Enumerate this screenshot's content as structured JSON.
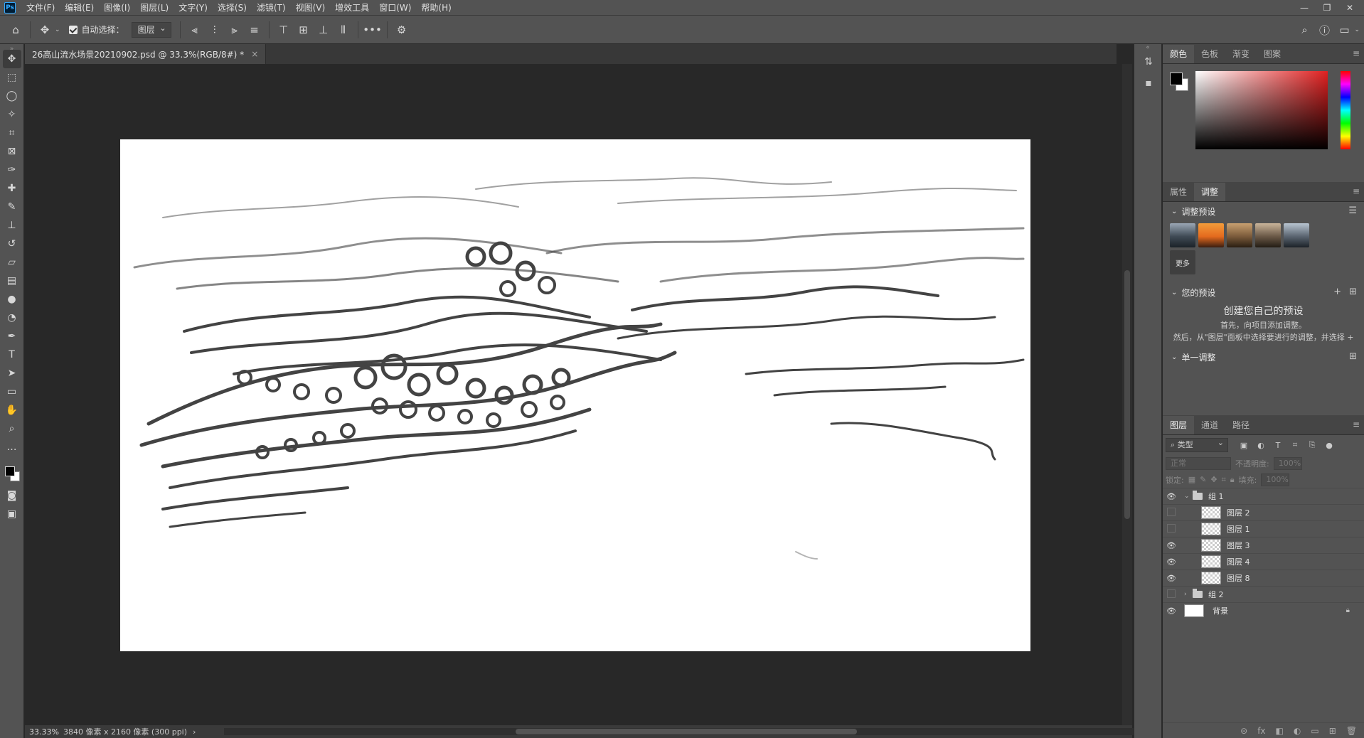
{
  "app": {
    "logo": "Ps"
  },
  "menu": [
    "文件(F)",
    "编辑(E)",
    "图像(I)",
    "图层(L)",
    "文字(Y)",
    "选择(S)",
    "滤镜(T)",
    "视图(V)",
    "增效工具",
    "窗口(W)",
    "帮助(H)"
  ],
  "options": {
    "auto_select_label": "自动选择：",
    "auto_select_value": "图层",
    "more": "•••"
  },
  "document": {
    "tab_title": "26高山流水场景20210902.psd @ 33.3%(RGB/8#) *",
    "close": "×"
  },
  "status": {
    "zoom": "33.33%",
    "info": "3840 像素 x 2160 像素 (300 ppi)",
    "arrow": "›"
  },
  "color_panel": {
    "tabs": [
      "颜色",
      "色板",
      "渐变",
      "图案"
    ],
    "fg": "#000000",
    "bg": "#ffffff"
  },
  "adjust_panel": {
    "tabs": [
      "属性",
      "调整"
    ],
    "presets_title": "调整预设",
    "more_label": "更多",
    "your_presets_title": "您的预设",
    "create_title": "创建您自己的预设",
    "hint1": "首先，向项目添加调整。",
    "hint2": "然后，从\"图层\"面板中选择要进行的调整，并选择 +",
    "single_adjust": "单一调整"
  },
  "layers_panel": {
    "tabs": [
      "图层",
      "通道",
      "路径"
    ],
    "filter_label": "类型",
    "blend_mode": "正常",
    "opacity_label": "不透明度:",
    "opacity_value": "100%",
    "lock_label": "锁定:",
    "fill_label": "填充:",
    "fill_value": "100%",
    "layers": [
      {
        "name": "组 1",
        "type": "group",
        "visible": true,
        "expanded": true,
        "indent": 0
      },
      {
        "name": "图层 2",
        "type": "layer",
        "visible": false,
        "indent": 1
      },
      {
        "name": "图层 1",
        "type": "layer",
        "visible": false,
        "indent": 1
      },
      {
        "name": "图层 3",
        "type": "layer",
        "visible": true,
        "indent": 1
      },
      {
        "name": "图层 4",
        "type": "layer",
        "visible": true,
        "indent": 1
      },
      {
        "name": "图层 8",
        "type": "layer",
        "visible": true,
        "indent": 1
      },
      {
        "name": "组 2",
        "type": "group",
        "visible": false,
        "expanded": false,
        "indent": 0
      },
      {
        "name": "背景",
        "type": "background",
        "visible": true,
        "locked": true,
        "indent": 0
      }
    ],
    "footer": [
      "⊝",
      "fx",
      "◧",
      "◐",
      "▭",
      "⊞",
      "🗑"
    ]
  },
  "icons": {
    "tools": [
      "move-icon",
      "marquee-icon",
      "lasso-icon",
      "magic-wand-icon",
      "crop-icon",
      "frame-icon",
      "eyedropper-icon",
      "healing-brush-icon",
      "brush-icon",
      "stamp-icon",
      "history-brush-icon",
      "eraser-icon",
      "gradient-icon",
      "blur-icon",
      "dodge-icon",
      "pen-icon",
      "type-icon",
      "path-select-icon",
      "rectangle-icon",
      "hand-icon",
      "zoom-icon",
      "more-tools-icon"
    ]
  }
}
